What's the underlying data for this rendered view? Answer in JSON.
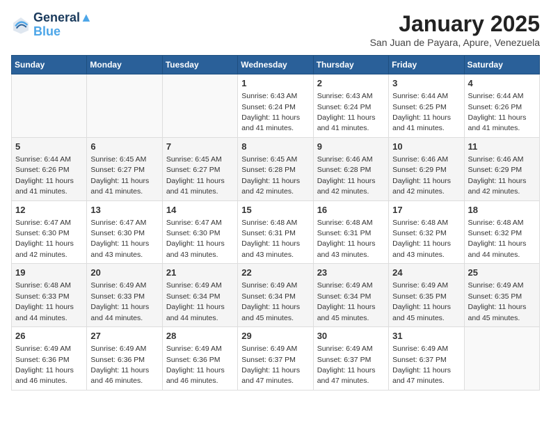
{
  "header": {
    "logo_line1": "General",
    "logo_line2": "Blue",
    "month_title": "January 2025",
    "location": "San Juan de Payara, Apure, Venezuela"
  },
  "weekdays": [
    "Sunday",
    "Monday",
    "Tuesday",
    "Wednesday",
    "Thursday",
    "Friday",
    "Saturday"
  ],
  "weeks": [
    [
      {
        "day": "",
        "info": ""
      },
      {
        "day": "",
        "info": ""
      },
      {
        "day": "",
        "info": ""
      },
      {
        "day": "1",
        "info": "Sunrise: 6:43 AM\nSunset: 6:24 PM\nDaylight: 11 hours and 41 minutes."
      },
      {
        "day": "2",
        "info": "Sunrise: 6:43 AM\nSunset: 6:24 PM\nDaylight: 11 hours and 41 minutes."
      },
      {
        "day": "3",
        "info": "Sunrise: 6:44 AM\nSunset: 6:25 PM\nDaylight: 11 hours and 41 minutes."
      },
      {
        "day": "4",
        "info": "Sunrise: 6:44 AM\nSunset: 6:26 PM\nDaylight: 11 hours and 41 minutes."
      }
    ],
    [
      {
        "day": "5",
        "info": "Sunrise: 6:44 AM\nSunset: 6:26 PM\nDaylight: 11 hours and 41 minutes."
      },
      {
        "day": "6",
        "info": "Sunrise: 6:45 AM\nSunset: 6:27 PM\nDaylight: 11 hours and 41 minutes."
      },
      {
        "day": "7",
        "info": "Sunrise: 6:45 AM\nSunset: 6:27 PM\nDaylight: 11 hours and 41 minutes."
      },
      {
        "day": "8",
        "info": "Sunrise: 6:45 AM\nSunset: 6:28 PM\nDaylight: 11 hours and 42 minutes."
      },
      {
        "day": "9",
        "info": "Sunrise: 6:46 AM\nSunset: 6:28 PM\nDaylight: 11 hours and 42 minutes."
      },
      {
        "day": "10",
        "info": "Sunrise: 6:46 AM\nSunset: 6:29 PM\nDaylight: 11 hours and 42 minutes."
      },
      {
        "day": "11",
        "info": "Sunrise: 6:46 AM\nSunset: 6:29 PM\nDaylight: 11 hours and 42 minutes."
      }
    ],
    [
      {
        "day": "12",
        "info": "Sunrise: 6:47 AM\nSunset: 6:30 PM\nDaylight: 11 hours and 42 minutes."
      },
      {
        "day": "13",
        "info": "Sunrise: 6:47 AM\nSunset: 6:30 PM\nDaylight: 11 hours and 43 minutes."
      },
      {
        "day": "14",
        "info": "Sunrise: 6:47 AM\nSunset: 6:30 PM\nDaylight: 11 hours and 43 minutes."
      },
      {
        "day": "15",
        "info": "Sunrise: 6:48 AM\nSunset: 6:31 PM\nDaylight: 11 hours and 43 minutes."
      },
      {
        "day": "16",
        "info": "Sunrise: 6:48 AM\nSunset: 6:31 PM\nDaylight: 11 hours and 43 minutes."
      },
      {
        "day": "17",
        "info": "Sunrise: 6:48 AM\nSunset: 6:32 PM\nDaylight: 11 hours and 43 minutes."
      },
      {
        "day": "18",
        "info": "Sunrise: 6:48 AM\nSunset: 6:32 PM\nDaylight: 11 hours and 44 minutes."
      }
    ],
    [
      {
        "day": "19",
        "info": "Sunrise: 6:48 AM\nSunset: 6:33 PM\nDaylight: 11 hours and 44 minutes."
      },
      {
        "day": "20",
        "info": "Sunrise: 6:49 AM\nSunset: 6:33 PM\nDaylight: 11 hours and 44 minutes."
      },
      {
        "day": "21",
        "info": "Sunrise: 6:49 AM\nSunset: 6:34 PM\nDaylight: 11 hours and 44 minutes."
      },
      {
        "day": "22",
        "info": "Sunrise: 6:49 AM\nSunset: 6:34 PM\nDaylight: 11 hours and 45 minutes."
      },
      {
        "day": "23",
        "info": "Sunrise: 6:49 AM\nSunset: 6:34 PM\nDaylight: 11 hours and 45 minutes."
      },
      {
        "day": "24",
        "info": "Sunrise: 6:49 AM\nSunset: 6:35 PM\nDaylight: 11 hours and 45 minutes."
      },
      {
        "day": "25",
        "info": "Sunrise: 6:49 AM\nSunset: 6:35 PM\nDaylight: 11 hours and 45 minutes."
      }
    ],
    [
      {
        "day": "26",
        "info": "Sunrise: 6:49 AM\nSunset: 6:36 PM\nDaylight: 11 hours and 46 minutes."
      },
      {
        "day": "27",
        "info": "Sunrise: 6:49 AM\nSunset: 6:36 PM\nDaylight: 11 hours and 46 minutes."
      },
      {
        "day": "28",
        "info": "Sunrise: 6:49 AM\nSunset: 6:36 PM\nDaylight: 11 hours and 46 minutes."
      },
      {
        "day": "29",
        "info": "Sunrise: 6:49 AM\nSunset: 6:37 PM\nDaylight: 11 hours and 47 minutes."
      },
      {
        "day": "30",
        "info": "Sunrise: 6:49 AM\nSunset: 6:37 PM\nDaylight: 11 hours and 47 minutes."
      },
      {
        "day": "31",
        "info": "Sunrise: 6:49 AM\nSunset: 6:37 PM\nDaylight: 11 hours and 47 minutes."
      },
      {
        "day": "",
        "info": ""
      }
    ]
  ]
}
